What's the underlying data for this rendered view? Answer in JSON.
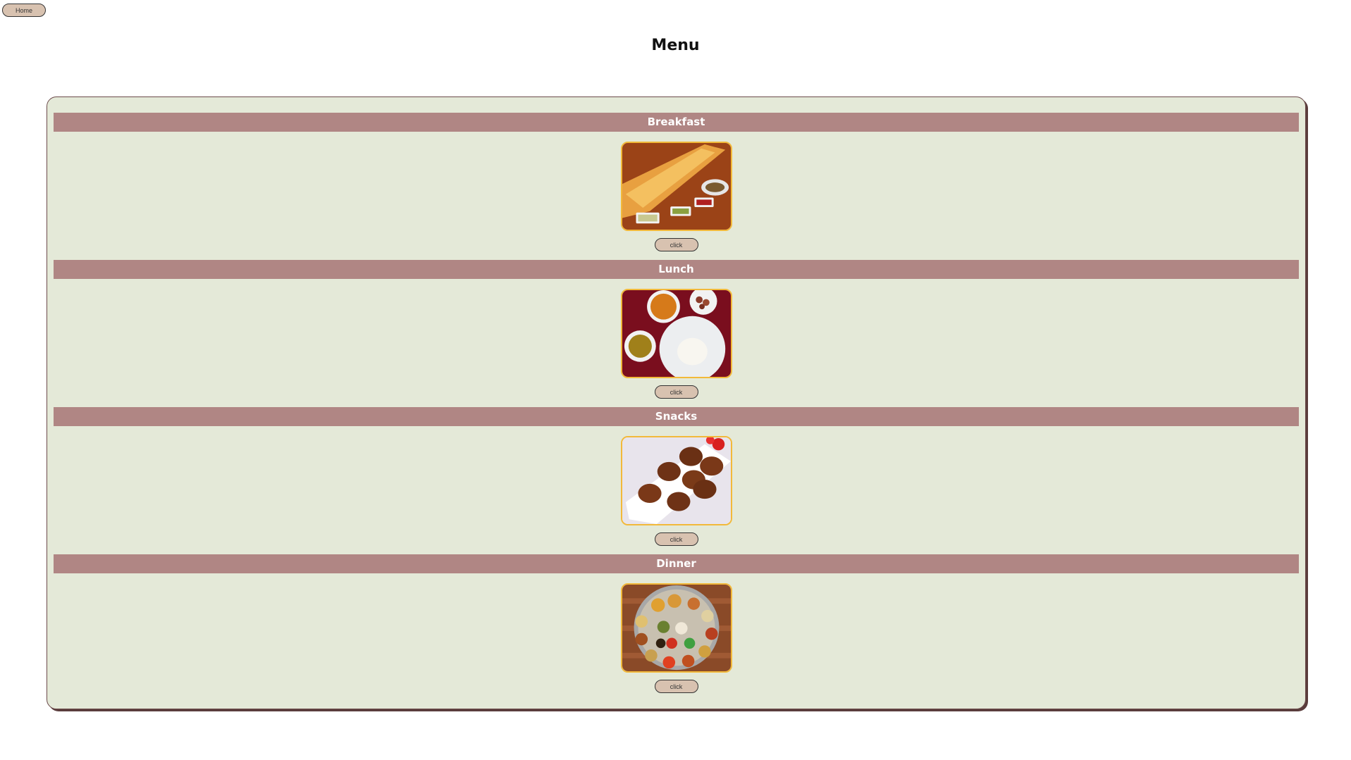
{
  "nav": {
    "home_label": "Home"
  },
  "page": {
    "title": "Menu"
  },
  "sections": [
    {
      "title": "Breakfast",
      "image": "dosa-photo",
      "button_label": "click"
    },
    {
      "title": "Lunch",
      "image": "rice-curry-photo",
      "button_label": "click"
    },
    {
      "title": "Snacks",
      "image": "cutlets-photo",
      "button_label": "click"
    },
    {
      "title": "Dinner",
      "image": "thali-photo",
      "button_label": "click"
    }
  ],
  "colors": {
    "card_bg": "#e4e9d8",
    "header_bg": "#b08684",
    "button_bg": "#d8c2b0",
    "image_border": "#f2b93a"
  }
}
